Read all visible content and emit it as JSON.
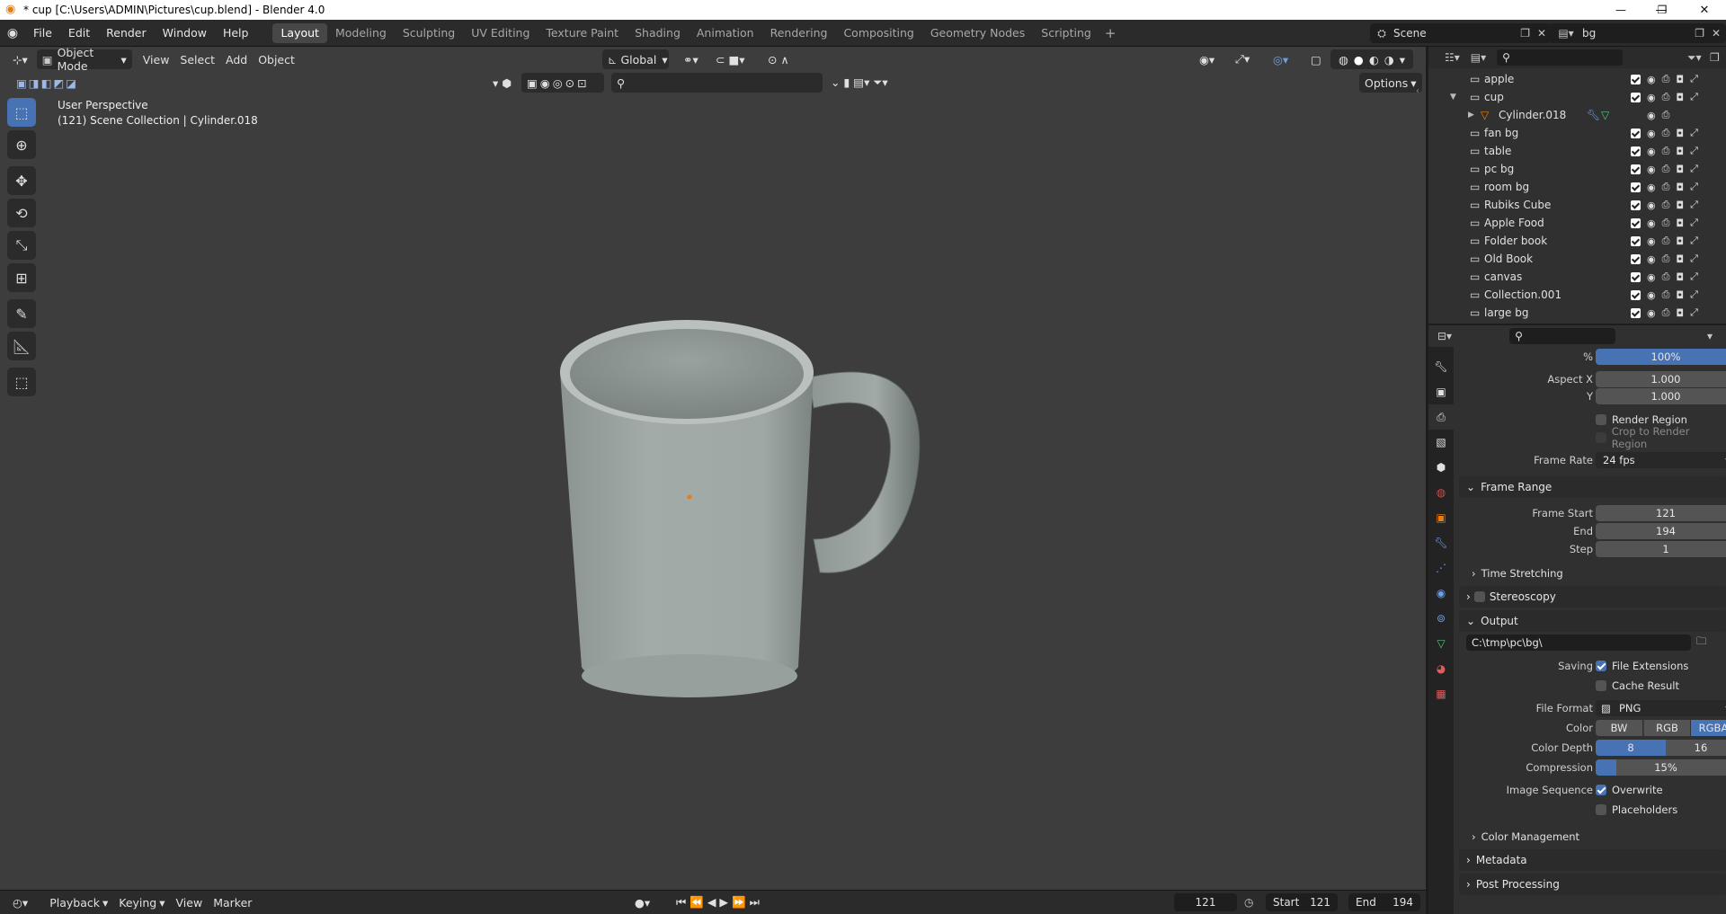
{
  "window": {
    "title": "* cup [C:\\Users\\ADMIN\\Pictures\\cup.blend] - Blender 4.0",
    "minimize": "—",
    "maximize": "❐",
    "close": "✕"
  },
  "menubar": {
    "items": [
      "File",
      "Edit",
      "Render",
      "Window",
      "Help"
    ]
  },
  "workspaces": {
    "tabs": [
      "Layout",
      "Modeling",
      "Sculpting",
      "UV Editing",
      "Texture Paint",
      "Shading",
      "Animation",
      "Rendering",
      "Compositing",
      "Geometry Nodes",
      "Scripting"
    ],
    "active": "Layout",
    "add": "+"
  },
  "scene_selector": {
    "value": "Scene"
  },
  "viewlayer_selector": {
    "value": "bg"
  },
  "viewport_header": {
    "mode": "Object Mode",
    "menus": [
      "View",
      "Select",
      "Add",
      "Object"
    ],
    "orientation": "Global",
    "options": "Options"
  },
  "viewport": {
    "perspective": "User Perspective",
    "collection_info": "(121) Scene Collection | Cylinder.018"
  },
  "tools": [
    "select-box",
    "cursor",
    "move",
    "rotate",
    "scale",
    "transform",
    "annotate",
    "measure",
    "add-cube"
  ],
  "outliner": {
    "rows": [
      {
        "name": "apple",
        "indent": 0
      },
      {
        "name": "cup",
        "indent": 0,
        "expanded": true
      },
      {
        "name": "Cylinder.018",
        "indent": 1,
        "type": "object"
      },
      {
        "name": "fan bg",
        "indent": 0
      },
      {
        "name": "table",
        "indent": 0
      },
      {
        "name": "pc bg",
        "indent": 0
      },
      {
        "name": "room bg",
        "indent": 0
      },
      {
        "name": "Rubiks Cube",
        "indent": 0
      },
      {
        "name": "Apple Food",
        "indent": 0
      },
      {
        "name": "Folder book",
        "indent": 0
      },
      {
        "name": "Old Book",
        "indent": 0
      },
      {
        "name": "canvas",
        "indent": 0
      },
      {
        "name": "Collection.001",
        "indent": 0
      },
      {
        "name": "large bg",
        "indent": 0
      }
    ]
  },
  "properties": {
    "percent_label": "%",
    "percent_value": "100%",
    "aspect_x_label": "Aspect X",
    "aspect_x": "1.000",
    "aspect_y_label": "Y",
    "aspect_y": "1.000",
    "render_region": "Render Region",
    "crop_region": "Crop to Render Region",
    "frame_rate_label": "Frame Rate",
    "frame_rate": "24 fps",
    "frame_range_header": "Frame Range",
    "frame_start_label": "Frame Start",
    "frame_start": "121",
    "end_label": "End",
    "end": "194",
    "step_label": "Step",
    "step": "1",
    "time_stretching": "Time Stretching",
    "stereoscopy": "Stereoscopy",
    "output_header": "Output",
    "output_path": "C:\\tmp\\pc\\bg\\",
    "saving_label": "Saving",
    "file_extensions": "File Extensions",
    "cache_result": "Cache Result",
    "file_format_label": "File Format",
    "file_format": "PNG",
    "color_label": "Color",
    "color_options": [
      "BW",
      "RGB",
      "RGBA"
    ],
    "color_active": "RGBA",
    "color_depth_label": "Color Depth",
    "color_depth_options": [
      "8",
      "16"
    ],
    "compression_label": "Compression",
    "compression": "15%",
    "compression_fraction": 0.15,
    "image_sequence_label": "Image Sequence",
    "overwrite": "Overwrite",
    "placeholders": "Placeholders",
    "color_management": "Color Management",
    "metadata": "Metadata",
    "post_processing": "Post Processing"
  },
  "timeline": {
    "menus": [
      "Playback",
      "Keying",
      "View",
      "Marker"
    ],
    "current_frame": "121",
    "start_label": "Start",
    "start": "121",
    "end_label": "End",
    "end": "194"
  },
  "colors": {
    "accent": "#4772b3",
    "origin_dot": "#e87d0d",
    "viewport_bg": "#3d3d3d"
  }
}
